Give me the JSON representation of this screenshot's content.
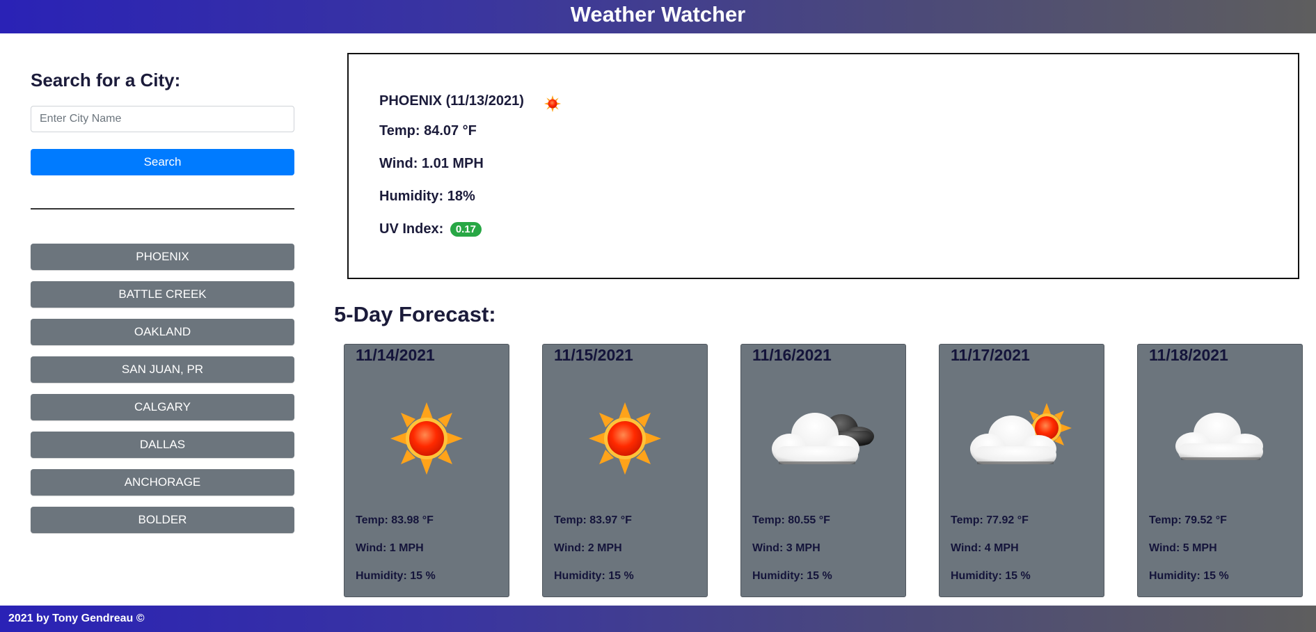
{
  "header": {
    "title": "Weather Watcher"
  },
  "sidebar": {
    "heading": "Search for a City:",
    "search_placeholder": "Enter City Name",
    "search_button": "Search",
    "cities": [
      "PHOENIX",
      "BATTLE CREEK",
      "OAKLAND",
      "SAN JUAN, PR",
      "CALGARY",
      "DALLAS",
      "ANCHORAGE",
      "BOLDER"
    ]
  },
  "current": {
    "city_date": "PHOENIX (11/13/2021)",
    "icon": "sun-icon",
    "temp": "Temp: 84.07 °F",
    "wind": "Wind: 1.01 MPH",
    "humidity": "Humidity: 18%",
    "uv_label": "UV Index:",
    "uv_value": "0.17",
    "uv_color": "#28a745"
  },
  "forecast": {
    "title": "5-Day Forecast:",
    "days": [
      {
        "date": "11/14/2021",
        "icon": "sun-icon",
        "temp": "Temp: 83.98 °F",
        "wind": "Wind: 1 MPH",
        "humidity": "Humidity: 15 %"
      },
      {
        "date": "11/15/2021",
        "icon": "sun-icon",
        "temp": "Temp: 83.97 °F",
        "wind": "Wind: 2 MPH",
        "humidity": "Humidity: 15 %"
      },
      {
        "date": "11/16/2021",
        "icon": "cloudy-night-icon",
        "temp": "Temp: 80.55 °F",
        "wind": "Wind: 3 MPH",
        "humidity": "Humidity: 15 %"
      },
      {
        "date": "11/17/2021",
        "icon": "partly-cloudy-icon",
        "temp": "Temp: 77.92 °F",
        "wind": "Wind: 4 MPH",
        "humidity": "Humidity: 15 %"
      },
      {
        "date": "11/18/2021",
        "icon": "cloud-icon",
        "temp": "Temp: 79.52 °F",
        "wind": "Wind: 5 MPH",
        "humidity": "Humidity: 15 %"
      }
    ]
  },
  "footer": {
    "text": "2021 by Tony Gendreau ©"
  }
}
